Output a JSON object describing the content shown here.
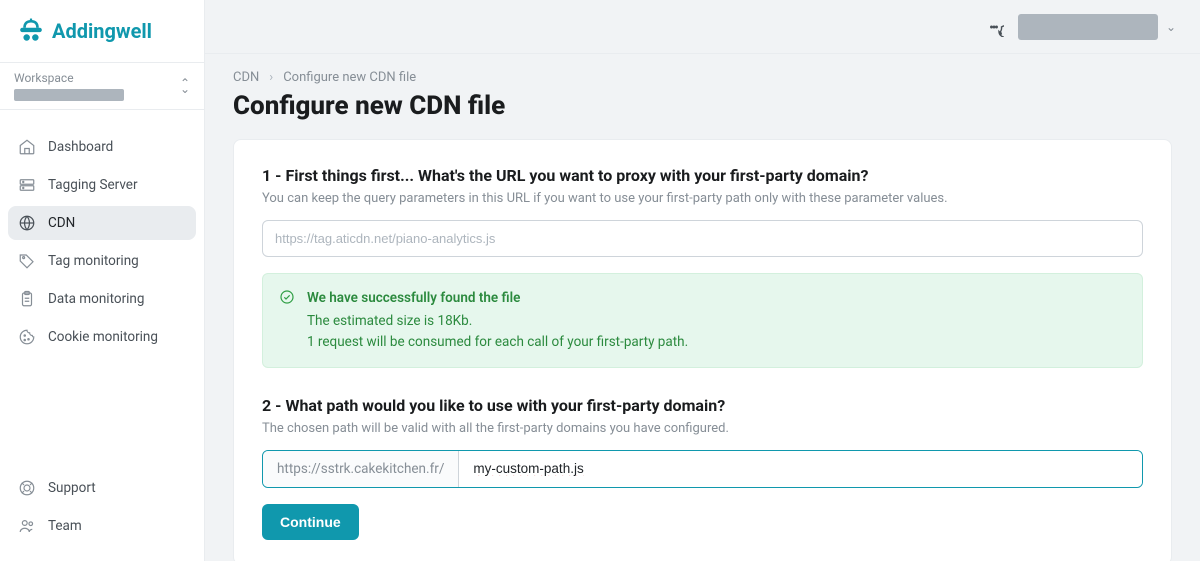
{
  "brand": {
    "name": "Addingwell"
  },
  "workspace": {
    "label": "Workspace"
  },
  "sidebar": {
    "items": [
      {
        "icon": "home-icon",
        "label": "Dashboard"
      },
      {
        "icon": "server-icon",
        "label": "Tagging Server"
      },
      {
        "icon": "globe-icon",
        "label": "CDN"
      },
      {
        "icon": "tag-icon",
        "label": "Tag monitoring"
      },
      {
        "icon": "clipboard-icon",
        "label": "Data monitoring"
      },
      {
        "icon": "cookie-icon",
        "label": "Cookie monitoring"
      }
    ],
    "footer": [
      {
        "icon": "lifebuoy-icon",
        "label": "Support"
      },
      {
        "icon": "users-icon",
        "label": "Team"
      }
    ]
  },
  "breadcrumb": {
    "root": "CDN",
    "current": "Configure new CDN file"
  },
  "page": {
    "title": "Configure new CDN file"
  },
  "step1": {
    "title": "1 - First things first... What's the URL you want to proxy with your first-party domain?",
    "subtitle": "You can keep the query parameters in this URL if you want to use your first-party path only with these parameter values.",
    "placeholder": "https://tag.aticdn.net/piano-analytics.js"
  },
  "alert": {
    "headline": "We have successfully found the file",
    "line1": "The estimated size is 18Kb.",
    "line2": "1 request will be consumed for each call of your first-party path."
  },
  "step2": {
    "title": "2 - What path would you like to use with your first-party domain?",
    "subtitle": "The chosen path will be valid with all the first-party domains you have configured.",
    "prefix": "https://sstrk.cakekitchen.fr/",
    "value": "my-custom-path.js"
  },
  "actions": {
    "continue": "Continue"
  }
}
